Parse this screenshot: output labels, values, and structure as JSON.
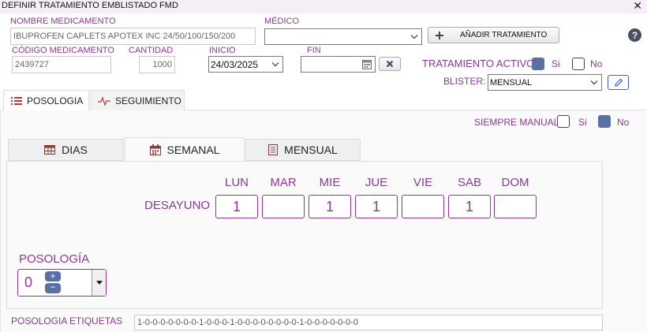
{
  "window": {
    "title": "DEFINIR TRATAMIENTO EMBLISTADO FMD"
  },
  "form": {
    "nombre_label": "NOMBRE MEDICAMENTO",
    "nombre_value": "IBUPROFEN CAPLETS APOTEX INC 24/50/100/150/200",
    "medico_label": "MÉDICO",
    "medico_value": "",
    "add_button": "AÑADIR TRATAMIENTO",
    "codigo_label": "CÓDIGO MEDICAMENTO",
    "codigo_value": "2439727",
    "cantidad_label": "CANTIDAD",
    "cantidad_value": "1000",
    "inicio_label": "INICIO",
    "inicio_value": "24/03/2025",
    "fin_label": "FIN",
    "fin_value": "",
    "activo_label": "TRATAMIENTO ACTIVO",
    "si_label": "Si",
    "no_label": "No",
    "activo_si_checked": true,
    "activo_no_checked": false,
    "blister_label": "BLISTER:",
    "blister_value": "MENSUAL"
  },
  "tabs": [
    {
      "label": "POSOLOGIA",
      "icon": "list-icon",
      "active": true
    },
    {
      "label": "SEGUIMIENTO",
      "icon": "heartbeat-icon",
      "active": false
    }
  ],
  "posologia": {
    "siempre_manual_label": "SIEMPRE MANUAL",
    "si_label": "Si",
    "no_label": "No",
    "manual_si_checked": false,
    "manual_no_checked": true,
    "subtabs": [
      {
        "label": "DIAS",
        "icon": "table-icon",
        "active": false
      },
      {
        "label": "SEMANAL",
        "icon": "calendar-icon",
        "active": true
      },
      {
        "label": "MENSUAL",
        "icon": "month-icon",
        "active": false
      }
    ],
    "days": [
      "LUN",
      "MAR",
      "MIE",
      "JUE",
      "VIE",
      "SAB",
      "DOM"
    ],
    "desayuno_label": "DESAYUNO",
    "desayuno_values": [
      "1",
      "",
      "1",
      "1",
      "",
      "1",
      ""
    ],
    "posologia_label": "POSOLOGÍA",
    "posologia_value": "0",
    "etiquetas_label": "POSOLOGIA ETIQUETAS",
    "etiquetas_value": "1-0-0-0-0-0-0-0-1-0-0-0-1-0-0-0-0-0-0-0-0-1-0-0-0-0-0-0-0"
  },
  "colors": {
    "accent": "#8a3a96",
    "check_on": "#5a6fa3",
    "titlebar_bg": "#f6eef7",
    "help_icon": "#4a4f63"
  }
}
